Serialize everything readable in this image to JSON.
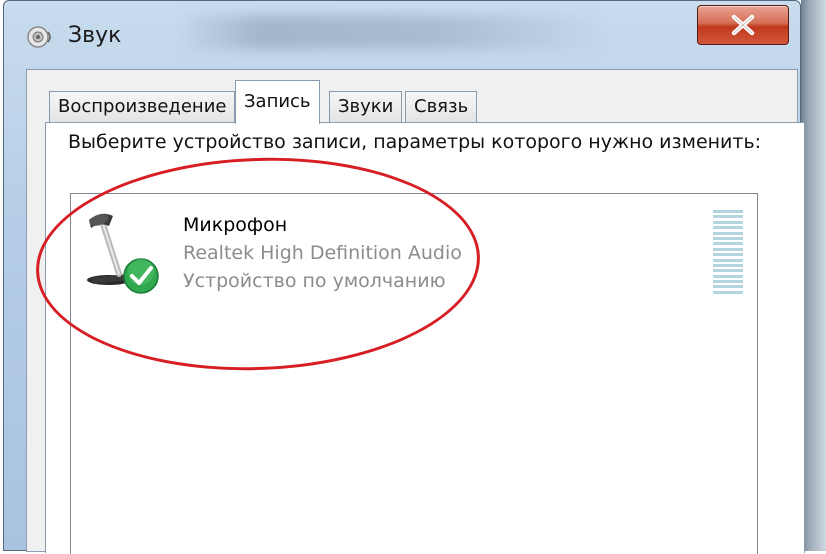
{
  "window": {
    "title": "Звук",
    "close_symbol": "X",
    "accent_color": "#c0391d"
  },
  "tabs": [
    {
      "label": "Воспроизведение",
      "active": false
    },
    {
      "label": "Запись",
      "active": true
    },
    {
      "label": "Звуки",
      "active": false
    },
    {
      "label": "Связь",
      "active": false
    }
  ],
  "panel": {
    "instructions": "Выберите устройство записи, параметры которого нужно изменить:"
  },
  "devices": [
    {
      "name": "Микрофон",
      "description": "Realtek High Definition Audio",
      "status": "Устройство по умолчанию",
      "icon": "microphone-icon",
      "default_badge_icon": "green-check-icon",
      "level_fraction": 0
    }
  ],
  "annotation": {
    "highlight_color": "#d61e24"
  }
}
